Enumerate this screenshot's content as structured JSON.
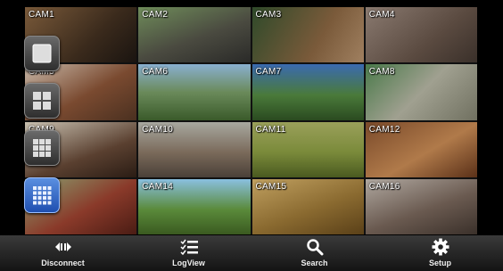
{
  "cameras": [
    {
      "label": "CAM1",
      "bg": "linear-gradient(135deg,#7a5a3a,#3a2a1c 60%,#1a1410)"
    },
    {
      "label": "CAM2",
      "bg": "linear-gradient(160deg,#6f8c5a,#4a4a40 55%,#2a2a28)"
    },
    {
      "label": "CAM3",
      "bg": "linear-gradient(120deg,#2f4a2a,#7a5a3a 60%,#a08060)"
    },
    {
      "label": "CAM4",
      "bg": "linear-gradient(140deg,#8a7a70,#5a4a40 60%,#3a302a)"
    },
    {
      "label": "CAM5",
      "bg": "linear-gradient(150deg,#c8b8a8,#7a4a30 55%,#4a3020)"
    },
    {
      "label": "CAM6",
      "bg": "linear-gradient(180deg,#8ab0d0,#6a8a5a 50%,#3a5a2a)"
    },
    {
      "label": "CAM7",
      "bg": "linear-gradient(180deg,#3a6ab0,#4a7a3a 55%,#2a4a20)"
    },
    {
      "label": "CAM8",
      "bg": "linear-gradient(135deg,#4a7a4a,#a0a090 50%,#707060)"
    },
    {
      "label": "CAM9",
      "bg": "linear-gradient(160deg,#c8c0b0,#5a4030 60%,#2a1c14)"
    },
    {
      "label": "CAM10",
      "bg": "linear-gradient(180deg,#a8a8a0,#7a6a5a 55%,#4a4038)"
    },
    {
      "label": "CAM11",
      "bg": "linear-gradient(180deg,#9aa05a,#7a8a3a 55%,#4a5a20)"
    },
    {
      "label": "CAM12",
      "bg": "linear-gradient(150deg,#7a4a2a,#b07a4a 55%,#5a3018)"
    },
    {
      "label": "CAM13",
      "bg": "linear-gradient(150deg,#8aa070,#8a3a2a 55%,#4a1c14)"
    },
    {
      "label": "CAM14",
      "bg": "linear-gradient(180deg,#8ac0e0,#5a8a3a 55%,#3a5a20)"
    },
    {
      "label": "CAM15",
      "bg": "linear-gradient(160deg,#c0a060,#8a6a30 55%,#5a4018)"
    },
    {
      "label": "CAM16",
      "bg": "linear-gradient(160deg,#b0a8a0,#6a5a50 55%,#3a302a)"
    }
  ],
  "view_buttons": [
    {
      "name": "single-view-button",
      "icon": "single-view-icon"
    },
    {
      "name": "quad-view-button",
      "icon": "quad-view-icon"
    },
    {
      "name": "nine-view-button",
      "icon": "nine-view-icon"
    },
    {
      "name": "sixteen-view-button",
      "icon": "sixteen-view-icon",
      "active": true
    }
  ],
  "bottom_bar": {
    "disconnect": {
      "label": "Disconnect",
      "icon": "disconnect-icon"
    },
    "logview": {
      "label": "LogView",
      "icon": "list-icon"
    },
    "search": {
      "label": "Search",
      "icon": "search-icon"
    },
    "setup": {
      "label": "Setup",
      "icon": "gear-icon"
    }
  },
  "colors": {
    "active_button": "#2f6ad0",
    "bar": "#2a2a2a"
  }
}
